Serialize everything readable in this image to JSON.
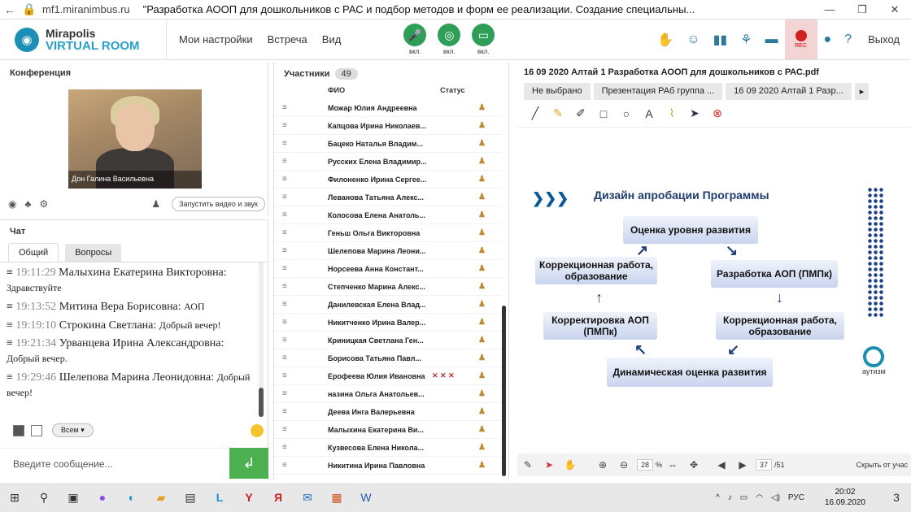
{
  "browser": {
    "url": "mf1.miranimbus.ru",
    "title": "\"Разработка АООП для дошкольников с РАС и подбор методов и форм ее реализации. Создание специальны..."
  },
  "app": {
    "logo_line1": "Mirapolis",
    "logo_line2": "VIRTUAL ROOM",
    "menu": [
      "Мои настройки",
      "Встреча",
      "Вид"
    ],
    "controls": [
      {
        "label": "вкл.",
        "icon": "mic-icon"
      },
      {
        "label": "вкл.",
        "icon": "camera-icon"
      },
      {
        "label": "вкл.",
        "icon": "screen-icon"
      }
    ],
    "rec_label": "REC",
    "exit_label": "Выход"
  },
  "conference": {
    "title": "Конференция",
    "video_caption": "Дон Галина  Васильевна",
    "start_video": "Запустить видео и звук"
  },
  "chat": {
    "title": "Чат",
    "tabs": [
      "Общий",
      "Вопросы"
    ],
    "messages": [
      {
        "time": "19:11:29",
        "author": "Малыхина  Екатерина Викторовна:",
        "text": "Здравствуйте"
      },
      {
        "time": "19:13:52",
        "author": "Митина Вера  Борисовна:",
        "text": "АОП"
      },
      {
        "time": "19:19:10",
        "author": "Строкина  Светлана:",
        "text": "Добрый вечер!"
      },
      {
        "time": "19:21:34",
        "author": "Урванцева  Ирина Александровна:",
        "text": "Добрый вечер."
      },
      {
        "time": "19:29:46",
        "author": "Шелепова  Марина Леонидовна:",
        "text": "Добрый вечер!"
      }
    ],
    "recipient": "Всем",
    "input_placeholder": "Введите сообщение..."
  },
  "participants": {
    "title": "Участники",
    "count": "49",
    "col_name": "ФИО",
    "col_status": "Статус",
    "rows": [
      "Можар Юлия Андреевна",
      "Капцова Ирина Николаев...",
      "Бацеко Наталья  Владим...",
      "Русских Елена Владимир...",
      "Филоненко Ирина Сергее...",
      "Леванова Татьяна  Алекс...",
      "Колосова Елена  Анатоль...",
      "Геньш Ольга  Викторовна",
      "Шелепова  Марина Леони...",
      "Норсеева Анна  Констант...",
      "Степченко Марина Алекс...",
      "Данилевская Елена  Влад...",
      "Никитченко  Ирина Валер...",
      "Криницкая Светлана  Ген...",
      "Борисова  Татьяна  Павл...",
      "Ерофеева Юлия  Ивановна",
      "назина  Ольга Анатольев...",
      "Деева Инга  Валерьевна",
      "Малыхина  Екатерина  Ви...",
      "Кузвесова Елена  Никола...",
      "Никитина Ирина  Павловна"
    ]
  },
  "document": {
    "title": "16 09 2020 Алтай  1 Разработка АООП для дошкольников с РАС.pdf",
    "tabs": [
      "Не выбрано",
      "Презентация РАб группа ...",
      "16 09 2020 Алтай  1 Разр..."
    ],
    "slide": {
      "title": "Дизайн апробации Программы",
      "boxes": [
        "Оценка уровня развития",
        "Разработка АОП (ПМПк)",
        "Коррекционная работа, образование",
        "Динамическая оценка развития",
        "Корректировка АОП (ПМПк)",
        "Коррекционная работа, образование"
      ],
      "logo_text": "аутизм"
    },
    "zoom": "28",
    "zoom_unit": "%",
    "page": "37",
    "pages": "/51",
    "hide_label": "Скрыть от учас"
  },
  "taskbar": {
    "lang": "РУС",
    "time": "20:02",
    "date": "16.09.2020",
    "notif": "3"
  }
}
